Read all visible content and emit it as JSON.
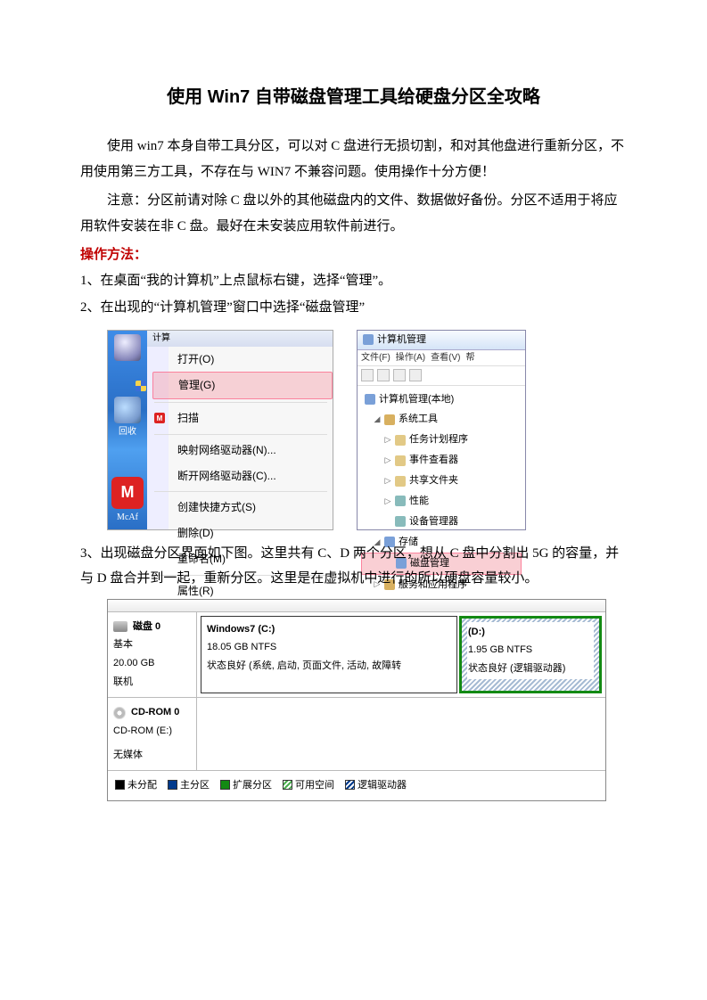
{
  "title": "使用 Win7 自带磁盘管理工具给硬盘分区全攻略",
  "para1": "使用 win7 本身自带工具分区，可以对 C 盘进行无损切割，和对其他盘进行重新分区，不用使用第三方工具，不存在与 WIN7 不兼容问题。使用操作十分方便！",
  "para2": "注意：分区前请对除 C 盘以外的其他磁盘内的文件、数据做好备份。分区不适用于将应用软件安装在非 C 盘。最好在未安装应用软件前进行。",
  "methodLabel": "操作方法：",
  "step1": "1、在桌面“我的计算机”上点鼠标右键，选择“管理”。",
  "step2": "2、在出现的“计算机管理”窗口中选择“磁盘管理”",
  "step3": "3、出现磁盘分区界面如下图。这里共有 C、D 两个分区，想从 C 盘中分割出 5G 的容量，并与 D 盘合并到一起，重新分区。这里是在虚拟机中进行的所以硬盘容量较小。",
  "ctx": {
    "topLabel": "计算",
    "open": "打开(O)",
    "manage": "管理(G)",
    "scan": "扫描",
    "mapNet": "映射网络驱动器(N)...",
    "disconnect": "断开网络驱动器(C)...",
    "shortcut": "创建快捷方式(S)",
    "delete": "删除(D)",
    "rename": "重命名(M)",
    "props": "属性(R)",
    "binLabel": "回收",
    "mcaf": "McAf"
  },
  "mgmt": {
    "winTitle": "计算机管理",
    "menus": [
      "文件(F)",
      "操作(A)",
      "查看(V)",
      "帮"
    ],
    "root": "计算机管理(本地)",
    "sysTools": "系统工具",
    "taskSched": "任务计划程序",
    "eventViewer": "事件查看器",
    "sharedFolders": "共享文件夹",
    "perf": "性能",
    "devMgr": "设备管理器",
    "storage": "存储",
    "diskMgmt": "磁盘管理",
    "services": "服务和应用程序"
  },
  "disk0": {
    "name": "磁盘 0",
    "type": "基本",
    "size": "20.00 GB",
    "status": "联机",
    "c": {
      "title": "Windows7 (C:)",
      "size": "18.05 GB NTFS",
      "state": "状态良好 (系统, 启动, 页面文件, 活动, 故障转"
    },
    "d": {
      "title": "(D:)",
      "size": "1.95 GB NTFS",
      "state": "状态良好 (逻辑驱动器)"
    }
  },
  "cdrom": {
    "name": "CD-ROM 0",
    "label": "CD-ROM (E:)",
    "state": "无媒体"
  },
  "legend": {
    "unalloc": "未分配",
    "primary": "主分区",
    "extended": "扩展分区",
    "free": "可用空间",
    "logical": "逻辑驱动器"
  }
}
